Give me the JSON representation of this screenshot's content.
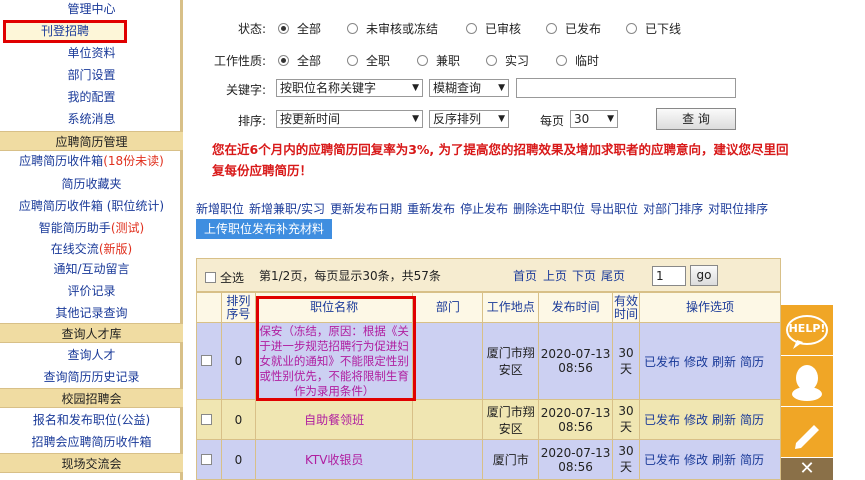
{
  "sidebar": {
    "links_top": [
      "管理中心",
      "单位资料",
      "部门设置",
      "我的配置",
      "系统消息"
    ],
    "active_item": "刊登招聘",
    "section_resume": "应聘简历管理",
    "resume_links": [
      {
        "text": "应聘简历收件箱",
        "hl": "(18份未读)"
      },
      {
        "text": "简历收藏夹",
        "hl": ""
      },
      {
        "text": "应聘简历收件箱 (职位统计)",
        "hl": ""
      },
      {
        "text": "智能简历助手",
        "hl": "(测试)"
      },
      {
        "text": "在线交流",
        "hl": "(新版)"
      },
      {
        "text": "通知/互动留言",
        "hl": ""
      },
      {
        "text": "评价记录",
        "hl": ""
      },
      {
        "text": "其他记录查询",
        "hl": ""
      }
    ],
    "section_talent": "查询人才库",
    "talent_links": [
      "查询人才",
      "查询简历历史记录"
    ],
    "section_campus": "校园招聘会",
    "campus_links": [
      "报名和发布职位(公益)",
      "招聘会应聘简历收件箱"
    ],
    "section_onsite": "现场交流会"
  },
  "filters": {
    "status_label": "状态:",
    "status_options": [
      "全部",
      "未审核或冻结",
      "已审核",
      "已发布",
      "已下线"
    ],
    "nature_label": "工作性质:",
    "nature_options": [
      "全部",
      "全职",
      "兼职",
      "实习",
      "临时"
    ],
    "keyword_label": "关键字:",
    "keyword_field_select": "按职位名称关键字",
    "keyword_match_select": "模糊查询",
    "keyword_value": "",
    "sort_label": "排序:",
    "sort_by_select": "按更新时间",
    "sort_order_select": "反序排列",
    "per_page_label": "每页",
    "per_page_select": "30",
    "query_button": "查 询"
  },
  "notice": "您在近6个月内的应聘简历回复率为3%, 为了提高您的招聘效果及增加求职者的应聘意向，建议您尽里回复每份应聘简历！",
  "actions": [
    "新增职位",
    "新增兼职/实习",
    "更新发布日期",
    "重新发布",
    "停止发布",
    "删除选中职位",
    "导出职位",
    "对部门排序",
    "对职位排序"
  ],
  "upload_button": "上传职位发布补充材料",
  "pager": {
    "select_all": "全选",
    "info": "第1/2页，每页显示30条，共57条",
    "first": "首页",
    "prev": "上页",
    "next": "下页",
    "last": "尾页",
    "page_value": "1",
    "go": "go"
  },
  "table": {
    "headers": [
      "排列序号",
      "职位名称",
      "部门",
      "工作地点",
      "发布时间",
      "有效时间",
      "操作选项"
    ],
    "rows": [
      {
        "seq": "0",
        "title": "保安（冻结，原因：根据《关于进一步规范招聘行为促进妇女就业的通知》不能限定性别或性别优先，不能将限制生育作为录用条件）",
        "dept": "",
        "location": "厦门市翔安区",
        "date": "2020-07-13",
        "time": "08:56",
        "valid": "30天",
        "ops": [
          "已发布",
          "修改",
          "刷新",
          "简历"
        ]
      },
      {
        "seq": "0",
        "title": "自助餐领班",
        "dept": "",
        "location": "厦门市翔安区",
        "date": "2020-07-13",
        "time": "08:56",
        "valid": "30天",
        "ops": [
          "已发布",
          "修改",
          "刷新",
          "简历"
        ]
      },
      {
        "seq": "0",
        "title": "KTV收银员",
        "dept": "",
        "location": "厦门市",
        "date": "2020-07-13",
        "time": "08:56",
        "valid": "30天",
        "ops": [
          "已发布",
          "修改",
          "刷新",
          "简历"
        ]
      }
    ]
  },
  "floaters": {
    "help": "HELP!",
    "close": "✕"
  },
  "colors": {
    "accent_red": "#e00000",
    "link_blue": "#1a3a99",
    "section_tan": "#f0dca2",
    "float_orange": "#f0a626"
  }
}
